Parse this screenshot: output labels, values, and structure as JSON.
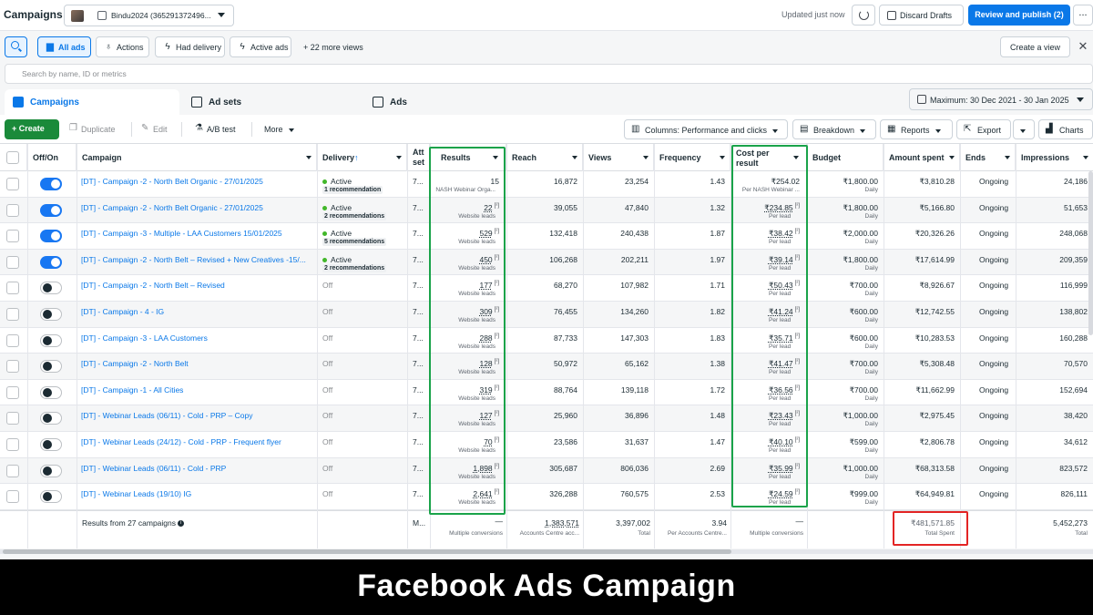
{
  "header": {
    "title": "Campaigns",
    "account": "Bindu2024 (365291372496...",
    "updated": "Updated just now",
    "discard_label": "Discard Drafts",
    "publish_label": "Review and publish (2)",
    "more_label": "..."
  },
  "views": {
    "all_ads": "All ads",
    "actions": "Actions",
    "had_delivery": "Had delivery",
    "active_ads": "Active ads",
    "more_views": "+  22 more views",
    "create_view": "Create a view",
    "close": "✕"
  },
  "search": {
    "placeholder": "Search by name, ID or metrics"
  },
  "tabs": {
    "campaigns": "Campaigns",
    "ad_sets": "Ad sets",
    "ads": "Ads"
  },
  "date_range": "Maximum: 30 Dec 2021 - 30 Jan 2025",
  "toolbar": {
    "create": "+  Create",
    "duplicate": "Duplicate",
    "edit": "Edit",
    "ab_test": "A/B test",
    "more": "More",
    "columns": "Columns: Performance and clicks",
    "breakdown": "Breakdown",
    "reports": "Reports",
    "export": "Export",
    "charts": "Charts"
  },
  "columns": {
    "off_on": "Off/On",
    "campaign": "Campaign",
    "delivery": "Delivery",
    "delivery_arrow": "↑",
    "attribution_line1": "Att",
    "attribution_line2": "set",
    "results": "Results",
    "reach": "Reach",
    "views": "Views",
    "frequency": "Frequency",
    "cpr_line1": "Cost per",
    "cpr_line2": "result",
    "budget": "Budget",
    "amount_spent": "Amount spent",
    "ends": "Ends",
    "impressions": "Impressions"
  },
  "rows": [
    {
      "on": true,
      "campaign": "[DT] - Campaign -2 - North Belt Organic - 27/01/2025",
      "delivery": "Active",
      "recommendation": "1 recommendation",
      "attribution": "7...",
      "results": "15",
      "results_sub": "NASH Webinar Orga...",
      "reach": "16,872",
      "views": "23,254",
      "frequency": "1.43",
      "cpr": "₹254.02",
      "cpr_sub": "Per NASH Webinar ...",
      "budget": "₹1,800.00",
      "budget_sub": "Daily",
      "spent": "₹3,810.28",
      "ends": "Ongoing",
      "impressions": "24,186"
    },
    {
      "on": true,
      "campaign": "[DT] - Campaign -2 - North Belt Organic - 27/01/2025",
      "delivery": "Active",
      "recommendation": "2 recommendations",
      "attribution": "7...",
      "results": "22",
      "results_sub": "Website leads",
      "reach": "39,055",
      "views": "47,840",
      "frequency": "1.32",
      "cpr": "₹234.85",
      "cpr_sub": "Per lead",
      "budget": "₹1,800.00",
      "budget_sub": "Daily",
      "spent": "₹5,166.80",
      "ends": "Ongoing",
      "impressions": "51,653"
    },
    {
      "on": true,
      "campaign": "[DT] - Campaign -3 - Multiple - LAA Customers 15/01/2025",
      "delivery": "Active",
      "recommendation": "5 recommendations",
      "attribution": "7...",
      "results": "529",
      "results_sub": "Website leads",
      "reach": "132,418",
      "views": "240,438",
      "frequency": "1.87",
      "cpr": "₹38.42",
      "cpr_sub": "Per lead",
      "budget": "₹2,000.00",
      "budget_sub": "Daily",
      "spent": "₹20,326.26",
      "ends": "Ongoing",
      "impressions": "248,068"
    },
    {
      "on": true,
      "campaign": "[DT] - Campaign -2 - North Belt – Revised + New Creatives -15/...",
      "delivery": "Active",
      "recommendation": "2 recommendations",
      "attribution": "7...",
      "results": "450",
      "results_sub": "Website leads",
      "reach": "106,268",
      "views": "202,211",
      "frequency": "1.97",
      "cpr": "₹39.14",
      "cpr_sub": "Per lead",
      "budget": "₹1,800.00",
      "budget_sub": "Daily",
      "spent": "₹17,614.99",
      "ends": "Ongoing",
      "impressions": "209,359"
    },
    {
      "on": false,
      "campaign": "[DT] - Campaign -2 - North Belt – Revised",
      "delivery": "Off",
      "recommendation": "",
      "attribution": "7...",
      "results": "177",
      "results_sub": "Website leads",
      "reach": "68,270",
      "views": "107,982",
      "frequency": "1.71",
      "cpr": "₹50.43",
      "cpr_sub": "Per lead",
      "budget": "₹700.00",
      "budget_sub": "Daily",
      "spent": "₹8,926.67",
      "ends": "Ongoing",
      "impressions": "116,999"
    },
    {
      "on": false,
      "campaign": "[DT] - Campaign - 4 - IG",
      "delivery": "Off",
      "recommendation": "",
      "attribution": "7...",
      "results": "309",
      "results_sub": "Website leads",
      "reach": "76,455",
      "views": "134,260",
      "frequency": "1.82",
      "cpr": "₹41.24",
      "cpr_sub": "Per lead",
      "budget": "₹600.00",
      "budget_sub": "Daily",
      "spent": "₹12,742.55",
      "ends": "Ongoing",
      "impressions": "138,802"
    },
    {
      "on": false,
      "campaign": "[DT] - Campaign -3 - LAA Customers",
      "delivery": "Off",
      "recommendation": "",
      "attribution": "7...",
      "results": "288",
      "results_sub": "Website leads",
      "reach": "87,733",
      "views": "147,303",
      "frequency": "1.83",
      "cpr": "₹35.71",
      "cpr_sub": "Per lead",
      "budget": "₹600.00",
      "budget_sub": "Daily",
      "spent": "₹10,283.53",
      "ends": "Ongoing",
      "impressions": "160,288"
    },
    {
      "on": false,
      "campaign": "[DT] - Campaign -2 - North Belt",
      "delivery": "Off",
      "recommendation": "",
      "attribution": "7...",
      "results": "128",
      "results_sub": "Website leads",
      "reach": "50,972",
      "views": "65,162",
      "frequency": "1.38",
      "cpr": "₹41.47",
      "cpr_sub": "Per lead",
      "budget": "₹700.00",
      "budget_sub": "Daily",
      "spent": "₹5,308.48",
      "ends": "Ongoing",
      "impressions": "70,570"
    },
    {
      "on": false,
      "campaign": "[DT] - Campaign -1 - All Cities",
      "delivery": "Off",
      "recommendation": "",
      "attribution": "7...",
      "results": "319",
      "results_sub": "Website leads",
      "reach": "88,764",
      "views": "139,118",
      "frequency": "1.72",
      "cpr": "₹36.56",
      "cpr_sub": "Per lead",
      "budget": "₹700.00",
      "budget_sub": "Daily",
      "spent": "₹11,662.99",
      "ends": "Ongoing",
      "impressions": "152,694"
    },
    {
      "on": false,
      "campaign": "[DT] - Webinar Leads (06/11) - Cold - PRP – Copy",
      "delivery": "Off",
      "recommendation": "",
      "attribution": "7...",
      "results": "127",
      "results_sub": "Website leads",
      "reach": "25,960",
      "views": "36,896",
      "frequency": "1.48",
      "cpr": "₹23.43",
      "cpr_sub": "Per lead",
      "budget": "₹1,000.00",
      "budget_sub": "Daily",
      "spent": "₹2,975.45",
      "ends": "Ongoing",
      "impressions": "38,420"
    },
    {
      "on": false,
      "campaign": "[DT] - Webinar Leads (24/12) - Cold - PRP - Frequent flyer",
      "delivery": "Off",
      "recommendation": "",
      "attribution": "7...",
      "results": "70",
      "results_sub": "Website leads",
      "reach": "23,586",
      "views": "31,637",
      "frequency": "1.47",
      "cpr": "₹40.10",
      "cpr_sub": "Per lead",
      "budget": "₹599.00",
      "budget_sub": "Daily",
      "spent": "₹2,806.78",
      "ends": "Ongoing",
      "impressions": "34,612"
    },
    {
      "on": false,
      "campaign": "[DT] - Webinar Leads (06/11) - Cold - PRP",
      "delivery": "Off",
      "recommendation": "",
      "attribution": "7...",
      "results": "1,898",
      "results_sub": "Website leads",
      "reach": "305,687",
      "views": "806,036",
      "frequency": "2.69",
      "cpr": "₹35.99",
      "cpr_sub": "Per lead",
      "budget": "₹1,000.00",
      "budget_sub": "Daily",
      "spent": "₹68,313.58",
      "ends": "Ongoing",
      "impressions": "823,572"
    },
    {
      "on": false,
      "campaign": "[DT] - Webinar Leads (19/10) IG",
      "delivery": "Off",
      "recommendation": "",
      "attribution": "7...",
      "results": "2,641",
      "results_sub": "Website leads",
      "reach": "326,288",
      "views": "760,575",
      "frequency": "2.53",
      "cpr": "₹24.59",
      "cpr_sub": "Per lead",
      "budget": "₹999.00",
      "budget_sub": "Daily",
      "spent": "₹64,949.81",
      "ends": "Ongoing",
      "impressions": "826,111"
    }
  ],
  "totals": {
    "label": "Results from 27 campaigns",
    "info": "i",
    "attribution": "M...",
    "results": "—",
    "results_sub": "Multiple conversions",
    "reach": "1,383,571",
    "reach_sub": "Accounts Centre acc...",
    "views": "3,397,002",
    "views_sub": "Total",
    "frequency": "3.94",
    "frequency_sub": "Per Accounts Centre...",
    "cpr": "—",
    "cpr_sub": "Multiple conversions",
    "spent": "₹481,571.85",
    "spent_sub": "Total Spent",
    "impressions": "5,452,273",
    "impressions_sub": "Total"
  },
  "banner": "Facebook Ads Campaign",
  "colors": {
    "accent": "#0a78e8",
    "create": "#1a8a3a",
    "highlight_green": "#1aa34a",
    "highlight_red": "#e32424"
  }
}
